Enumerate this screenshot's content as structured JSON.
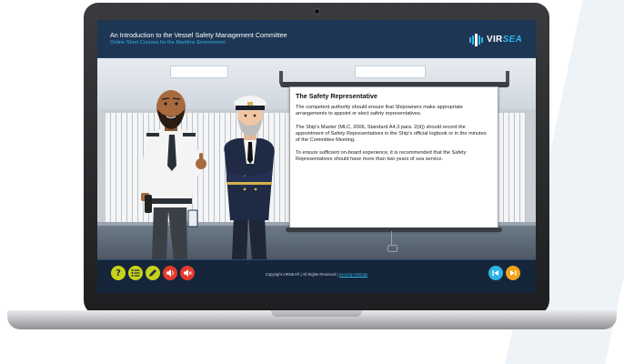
{
  "course": {
    "title": "An Introduction to the Vessel Safety Management Committee",
    "subtitle": "Online Short Courses for the Maritime Environment"
  },
  "logo": {
    "text_main": "VIR",
    "text_accent": "SEA",
    "icon": "virsea-logo-icon"
  },
  "slide": {
    "heading": "The Safety Representative",
    "paragraphs": [
      "The competent authority should ensure that Shipowners make appropriate arrangements to appoint or elect safety representatives.",
      "The Ship's Master (MLC, 2006, Standard A4.3 para. 2(d)) should record the appointment of Safety Representatives in the Ship's official logbook or in the minutes of the Committee Meeting.",
      "To ensure sufficient on-board experience, it is recommended that the Safety Representatives should have more than two years of sea service."
    ]
  },
  "footer": {
    "buttons": [
      {
        "name": "help-button",
        "icon": "question-icon",
        "color": "#c8d21a"
      },
      {
        "name": "menu-button",
        "icon": "list-icon",
        "color": "#c8d21a"
      },
      {
        "name": "edit-button",
        "icon": "pencil-icon",
        "color": "#c8d21a"
      },
      {
        "name": "audio-button",
        "icon": "speaker-icon",
        "color": "#e23b2e"
      },
      {
        "name": "mute-button",
        "icon": "speaker-off-icon",
        "color": "#e23b2e"
      }
    ],
    "copyright_text": "Copyright VIRSEA® | All Rights Reserved |",
    "copyright_link": "Security Settings",
    "nav": [
      {
        "name": "previous-button",
        "icon": "skip-back-icon",
        "color": "#2fb4e6"
      },
      {
        "name": "next-button",
        "icon": "skip-forward-icon",
        "color": "#f2a21b"
      }
    ]
  },
  "colors": {
    "header_bg": "#1d3654",
    "accent": "#2fb4e6",
    "footer_bg": "#15263b"
  }
}
